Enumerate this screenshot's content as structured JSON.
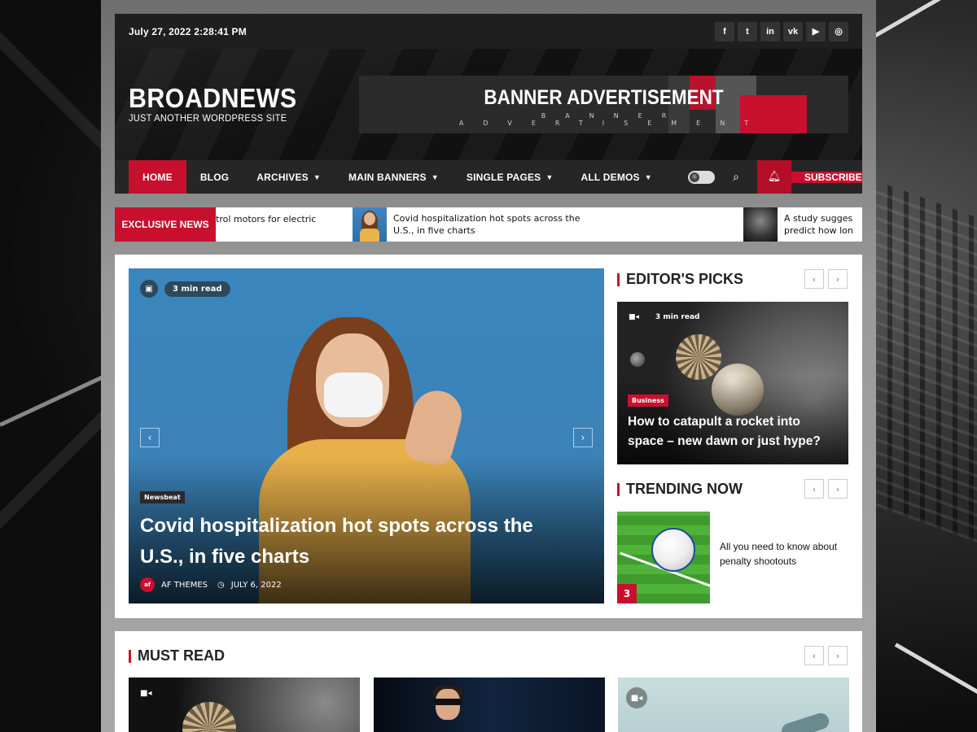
{
  "topbar": {
    "date": "July 27, 2022 2:28:41 PM",
    "socials": [
      "f",
      "t",
      "in",
      "vk",
      "▶",
      "◎"
    ]
  },
  "site": {
    "title": "BROADNEWS",
    "tagline": "JUST ANOTHER WORDPRESS SITE"
  },
  "banner": {
    "title": "BANNER ADVERTISEMENT",
    "subtitle": "BANNER ADVERTISEMENT"
  },
  "nav": {
    "items": [
      {
        "label": "HOME"
      },
      {
        "label": "BLOG"
      },
      {
        "label": "ARCHIVES"
      },
      {
        "label": "MAIN BANNERS"
      },
      {
        "label": "SINGLE PAGES"
      },
      {
        "label": "ALL DEMOS"
      }
    ],
    "subscribe": "SUBSCRIBE"
  },
  "ticker": {
    "label": "EXCLUSIVE NEWS",
    "items": [
      {
        "text": "trol motors for electric"
      },
      {
        "text": "Covid hospitalization hot spots across the U.S., in five charts"
      },
      {
        "text": "A study sugges predict how lon"
      }
    ]
  },
  "hero": {
    "read_time": "3 min read",
    "category": "Newsbeat",
    "title": "Covid hospitalization hot spots across the U.S., in five charts",
    "author": "AF THEMES",
    "date": "JULY 6, 2022",
    "author_initials": "af"
  },
  "editors_picks": {
    "heading": "EDITOR'S PICKS",
    "read_time": "3 min read",
    "category": "Business",
    "title": "How to catapult a rocket into space – new dawn or just hype?"
  },
  "trending": {
    "heading": "TRENDING NOW",
    "rank": "3",
    "title": "All you need to know about penalty shootouts"
  },
  "must_read": {
    "heading": "MUST READ"
  },
  "colors": {
    "accent": "#c8102e",
    "dark_bar": "#1f1f1f",
    "nav_bg": "#262626"
  }
}
